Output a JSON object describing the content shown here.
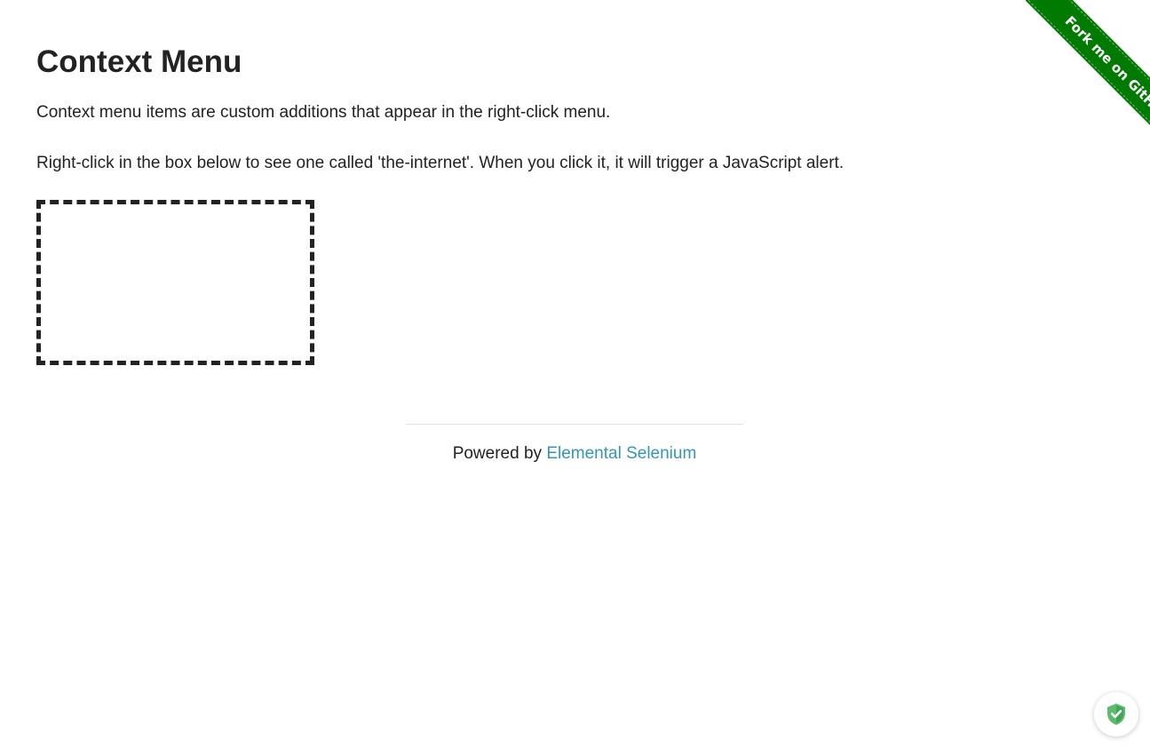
{
  "page": {
    "title": "Context Menu",
    "paragraphs": [
      "Context menu items are custom additions that appear in the right-click menu.",
      "Right-click in the box below to see one called 'the-internet'. When you click it, it will trigger a JavaScript alert."
    ]
  },
  "footer": {
    "prefix": "Powered by ",
    "link_label": "Elemental Selenium"
  },
  "ribbon": {
    "label": "Fork me on GitHub",
    "color": "#007a00"
  },
  "badge": {
    "icon": "shield-check-icon",
    "color": "#4caf50"
  },
  "colors": {
    "link": "#3396b8",
    "text": "#222222"
  }
}
